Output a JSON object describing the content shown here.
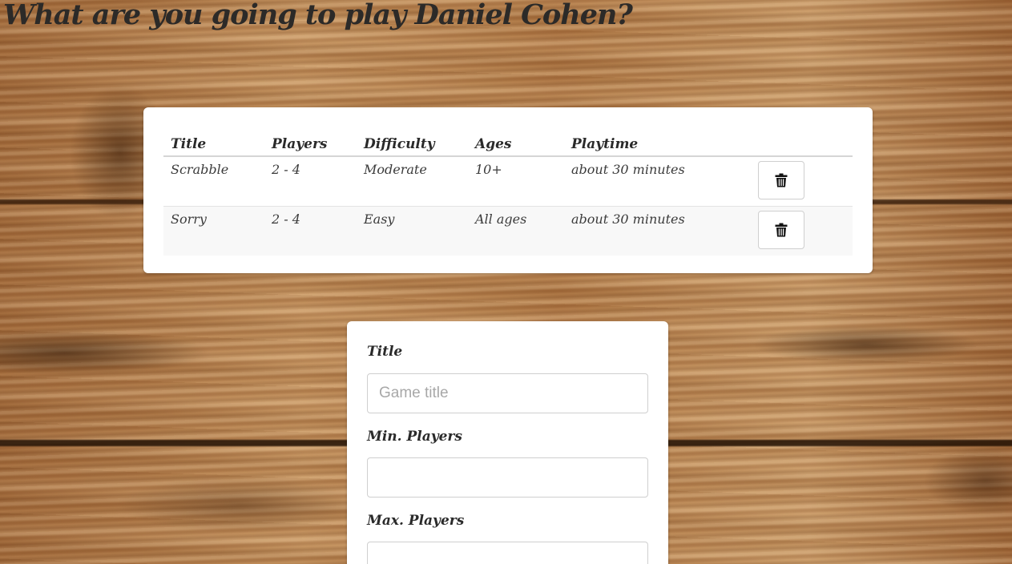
{
  "header": {
    "title": "What are you going to play Daniel Cohen?"
  },
  "games_table": {
    "columns": [
      "Title",
      "Players",
      "Difficulty",
      "Ages",
      "Playtime"
    ],
    "rows": [
      {
        "title": "Scrabble",
        "players": "2 - 4",
        "difficulty": "Moderate",
        "ages": "10+",
        "playtime": "about 30 minutes",
        "action_icon": "trash-icon"
      },
      {
        "title": "Sorry",
        "players": "2 - 4",
        "difficulty": "Easy",
        "ages": "All ages",
        "playtime": "about 30 minutes",
        "action_icon": "trash-icon"
      }
    ]
  },
  "add_game_form": {
    "title_label": "Title",
    "title_placeholder": "Game title",
    "title_value": "",
    "min_players_label": "Min. Players",
    "min_players_value": "",
    "max_players_label": "Max. Players",
    "max_players_value": ""
  },
  "colors": {
    "text_dark": "#2c2a28",
    "card_background": "#ffffff",
    "row_stripe": "#f8f8f8",
    "border": "#cfcfcf",
    "wood_base": "#b8844f"
  }
}
